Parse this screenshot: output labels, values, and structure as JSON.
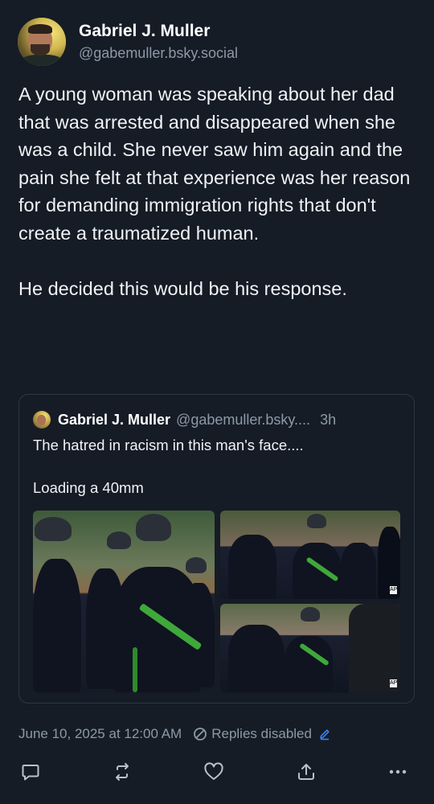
{
  "author": {
    "display_name": "Gabriel J. Muller",
    "handle": "@gabemuller.bsky.social"
  },
  "post": {
    "paragraphs": [
      "A young woman was speaking about her dad that was arrested and disappeared when she was a child. She never saw him again and the pain she felt at that experience was her reason for demanding immigration rights that don't create a traumatized human.",
      "He decided this would be his response."
    ]
  },
  "quote": {
    "display_name": "Gabriel J. Muller",
    "handle": "@gabemuller.bsky....",
    "time": "3h",
    "paragraphs": [
      "The hatred in racism in this man's face....",
      "Loading a 40mm"
    ]
  },
  "footer": {
    "timestamp": "June 10, 2025 at 12:00 AM",
    "replies_status": "Replies disabled"
  },
  "icons": {
    "reply": "reply-icon",
    "repost": "repost-icon",
    "like": "heart-icon",
    "share": "share-icon",
    "more": "more-icon"
  },
  "colors": {
    "background": "#151c26",
    "text": "#f1f3f5",
    "muted": "#8d99a6",
    "accent": "#3b82f6"
  }
}
